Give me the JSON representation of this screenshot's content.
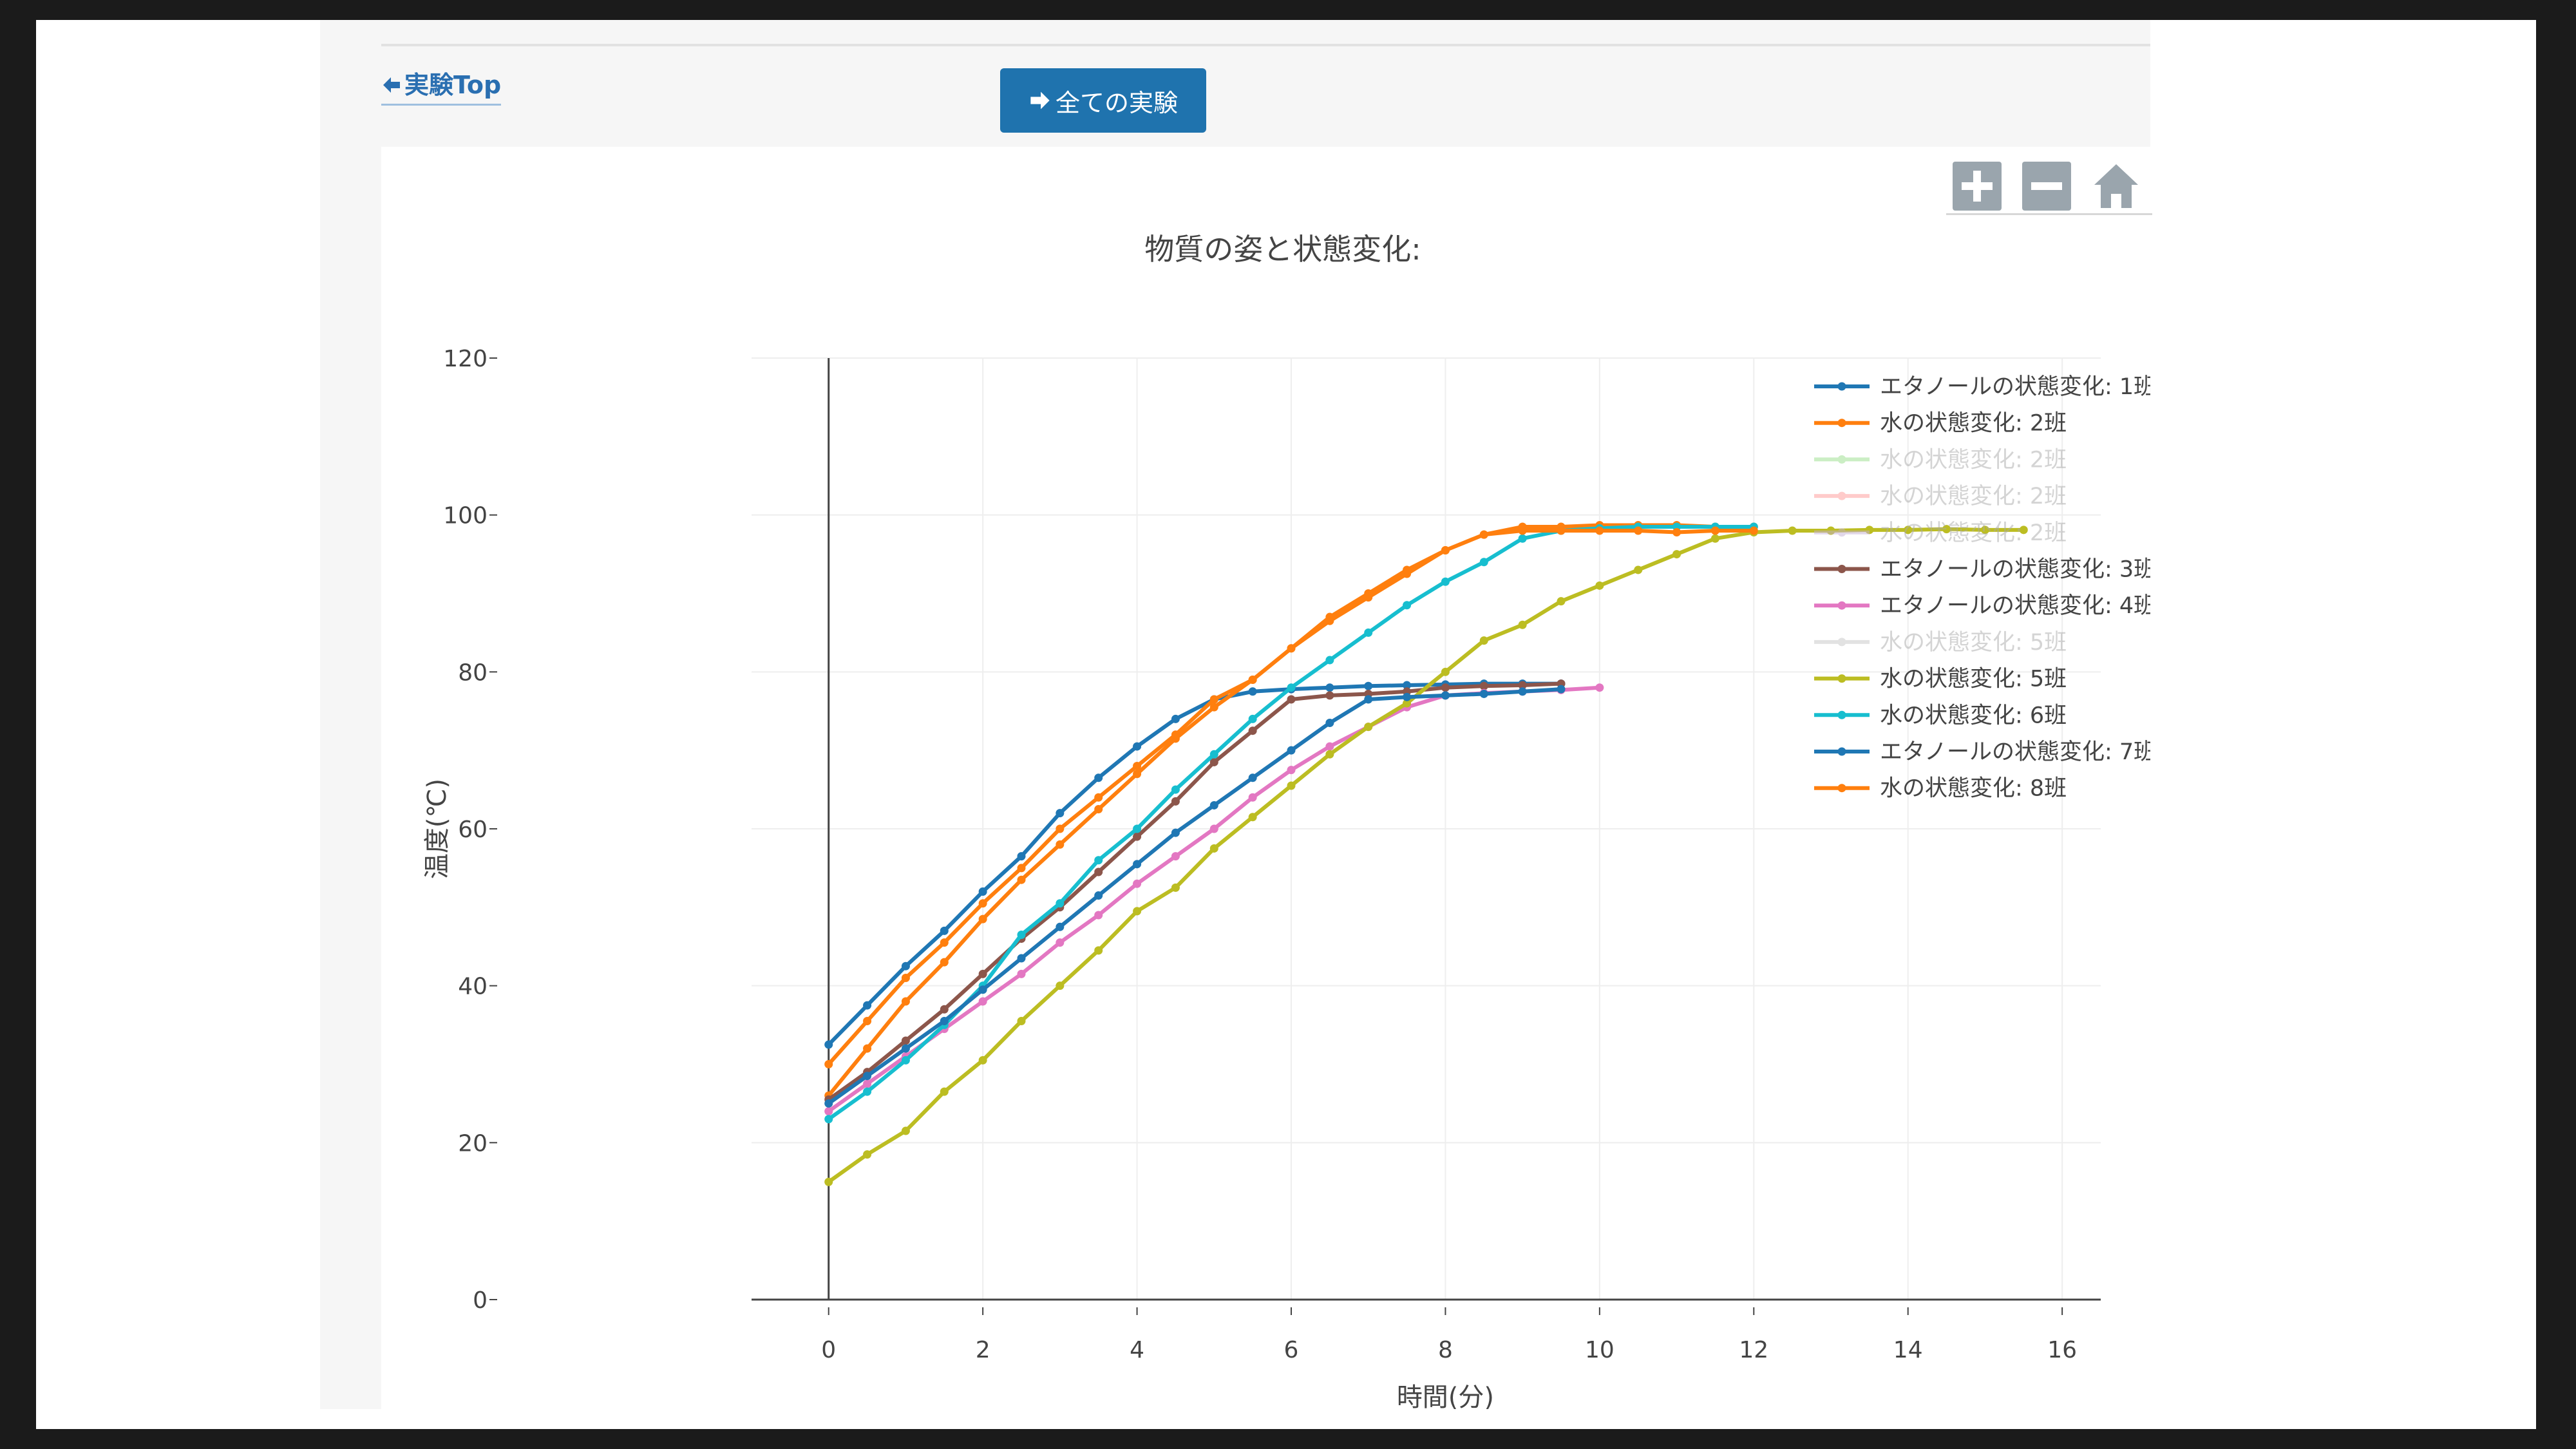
{
  "nav": {
    "back_label": "実験Top",
    "all_label": "全ての実験"
  },
  "modebar": {
    "zoom_in_icon": "plus-square-icon",
    "zoom_out_icon": "minus-square-icon",
    "home_icon": "home-icon"
  },
  "colors": {
    "accent": "#1f73ae",
    "link": "#2a6fb1",
    "grid": "#eeeeee",
    "legend_text": "#444444",
    "legend_text_hidden": "#aaaaaa"
  },
  "chart_data": {
    "type": "line",
    "title": "物質の姿と状態変化:",
    "xlabel": "時間(分)",
    "ylabel": "温度(℃)",
    "xlim": [
      -1,
      16.5
    ],
    "ylim": [
      0,
      120
    ],
    "xticks": [
      0,
      2,
      4,
      6,
      8,
      10,
      12,
      14,
      16
    ],
    "yticks": [
      0,
      20,
      40,
      60,
      80,
      100,
      120
    ],
    "grid": true,
    "legend_position": "right",
    "series": [
      {
        "name": "エタノールの状態変化: 1班",
        "color": "#1f77b4",
        "visible": true,
        "x": [
          0,
          0.5,
          1,
          1.5,
          2,
          2.5,
          3,
          3.5,
          4,
          4.5,
          5,
          5.5,
          6,
          6.5,
          7,
          7.5,
          8,
          8.5,
          9,
          9.5
        ],
        "y": [
          32.5,
          37.5,
          42.5,
          47,
          52,
          56.5,
          62,
          66.5,
          70.5,
          74,
          76.5,
          77.5,
          77.8,
          78,
          78.2,
          78.3,
          78.4,
          78.5,
          78.5,
          78.5
        ]
      },
      {
        "name": "水の状態変化: 2班",
        "color": "#ff7f0e",
        "visible": true,
        "x": [
          0,
          0.5,
          1,
          1.5,
          2,
          2.5,
          3,
          3.5,
          4,
          4.5,
          5,
          5.5,
          6,
          6.5,
          7,
          7.5,
          8,
          8.5,
          9,
          9.5,
          10,
          10.5,
          11,
          11.5,
          12
        ],
        "y": [
          26,
          32,
          38,
          43,
          48.5,
          53.5,
          58,
          62.5,
          67,
          71.5,
          75.5,
          79,
          83,
          86.5,
          89.5,
          92.5,
          95.5,
          97.5,
          98.5,
          98.5,
          98.7,
          98.7,
          98.7,
          98.5,
          98.5
        ]
      },
      {
        "name": "水の状態変化: 2班",
        "color": "#98df8a",
        "visible": false,
        "x": [],
        "y": []
      },
      {
        "name": "水の状態変化: 2班",
        "color": "#ff9896",
        "visible": false,
        "x": [],
        "y": []
      },
      {
        "name": "水の状態変化: 2班",
        "color": "#c5b0d5",
        "visible": false,
        "x": [],
        "y": []
      },
      {
        "name": "エタノールの状態変化: 3班",
        "color": "#8c564b",
        "visible": true,
        "x": [
          0,
          0.5,
          1,
          1.5,
          2,
          2.5,
          3,
          3.5,
          4,
          4.5,
          5,
          5.5,
          6,
          6.5,
          7,
          7.5,
          8,
          8.5,
          9,
          9.5
        ],
        "y": [
          25.5,
          29,
          33,
          37,
          41.5,
          46,
          50,
          54.5,
          59,
          63.5,
          68.5,
          72.5,
          76.5,
          77,
          77.2,
          77.5,
          78,
          78.2,
          78.3,
          78.5
        ]
      },
      {
        "name": "エタノールの状態変化: 4班",
        "color": "#e377c2",
        "visible": true,
        "x": [
          0,
          0.5,
          1,
          1.5,
          2,
          2.5,
          3,
          3.5,
          4,
          4.5,
          5,
          5.5,
          6,
          6.5,
          7,
          7.5,
          8,
          8.5,
          9,
          9.5,
          10
        ],
        "y": [
          24,
          27.5,
          31,
          34.5,
          38,
          41.5,
          45.5,
          49,
          53,
          56.5,
          60,
          64,
          67.5,
          70.5,
          73,
          75.5,
          77,
          77.3,
          77.5,
          77.7,
          78
        ]
      },
      {
        "name": "水の状態変化: 5班",
        "color": "#c7c7c7",
        "visible": false,
        "x": [],
        "y": []
      },
      {
        "name": "水の状態変化: 5班",
        "color": "#bcbd22",
        "visible": true,
        "x": [
          0,
          0.5,
          1,
          1.5,
          2,
          2.5,
          3,
          3.5,
          4,
          4.5,
          5,
          5.5,
          6,
          6.5,
          7,
          7.5,
          8,
          8.5,
          9,
          9.5,
          10,
          10.5,
          11,
          11.5,
          12,
          12.5,
          13,
          13.5,
          14,
          14.5,
          15,
          15.5
        ],
        "y": [
          15,
          18.5,
          21.5,
          26.5,
          30.5,
          35.5,
          40,
          44.5,
          49.5,
          52.5,
          57.5,
          61.5,
          65.5,
          69.5,
          73,
          76,
          80,
          84,
          86,
          89,
          91,
          93,
          95,
          97,
          97.8,
          98,
          98,
          98.1,
          98.1,
          98.2,
          98.1,
          98.1
        ]
      },
      {
        "name": "水の状態変化: 6班",
        "color": "#17becf",
        "visible": true,
        "x": [
          0,
          0.5,
          1,
          1.5,
          2,
          2.5,
          3,
          3.5,
          4,
          4.5,
          5,
          5.5,
          6,
          6.5,
          7,
          7.5,
          8,
          8.5,
          9,
          9.5,
          10,
          10.5,
          11,
          11.5,
          12
        ],
        "y": [
          23,
          26.5,
          30.5,
          35,
          40,
          46.5,
          50.5,
          56,
          60,
          65,
          69.5,
          74,
          78,
          81.5,
          85,
          88.5,
          91.5,
          94,
          97,
          98,
          98.3,
          98.5,
          98.5,
          98.5,
          98.5
        ]
      },
      {
        "name": "エタノールの状態変化: 7班",
        "color": "#1f77b4",
        "visible": true,
        "x": [
          0,
          0.5,
          1,
          1.5,
          2,
          2.5,
          3,
          3.5,
          4,
          4.5,
          5,
          5.5,
          6,
          6.5,
          7,
          7.5,
          8,
          8.5,
          9,
          9.5
        ],
        "y": [
          25,
          28.5,
          32,
          35.5,
          39.5,
          43.5,
          47.5,
          51.5,
          55.5,
          59.5,
          63,
          66.5,
          70,
          73.5,
          76.5,
          76.8,
          77,
          77.2,
          77.5,
          77.8
        ]
      },
      {
        "name": "水の状態変化: 8班",
        "color": "#ff7f0e",
        "visible": true,
        "x": [
          0,
          0.5,
          1,
          1.5,
          2,
          2.5,
          3,
          3.5,
          4,
          4.5,
          5,
          5.5,
          6,
          6.5,
          7,
          7.5,
          8,
          8.5,
          9,
          9.5,
          10,
          10.5,
          11,
          11.5,
          12
        ],
        "y": [
          30,
          35.5,
          41,
          45.5,
          50.5,
          55,
          60,
          64,
          68,
          72,
          76.5,
          79,
          83,
          87,
          90,
          93,
          95.5,
          97.5,
          98,
          98,
          98,
          98,
          97.8,
          98,
          98
        ]
      }
    ]
  }
}
